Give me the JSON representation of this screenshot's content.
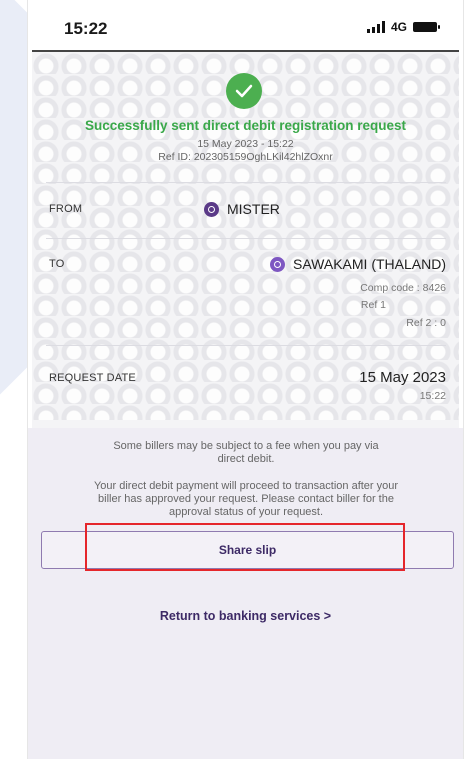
{
  "status_bar": {
    "time": "15:22",
    "network": "4G"
  },
  "result": {
    "title": "Successfully sent direct debit registration request",
    "datetime": "15 May 2023 - 15:22",
    "ref_id": "Ref ID: 202305159OghLKil42hlZOxnr"
  },
  "details": {
    "from_label": "FROM",
    "from_value": "MISTER",
    "to_label": "TO",
    "to_value": "SAWAKAMI (THALAND)",
    "comp_code": "Comp code : 8426",
    "ref1": "Ref 1",
    "ref2": "Ref 2 : 0",
    "request_date_label": "REQUEST DATE",
    "request_date": "15 May 2023",
    "request_time": "15:22"
  },
  "notes": {
    "fee_line1": "Some billers may be subject to a fee when you pay via",
    "fee_line2": "direct debit.",
    "approval_line1": "Your direct debit payment will proceed to transaction after your",
    "approval_line2": "biller has approved your request. Please contact biller for the",
    "approval_line3": "approval status of your request."
  },
  "actions": {
    "share_label": "Share slip",
    "return_label": "Return to banking services >"
  },
  "colors": {
    "success": "#3aa84a",
    "brand_purple": "#3d2a66",
    "highlight": "#e5262b"
  }
}
